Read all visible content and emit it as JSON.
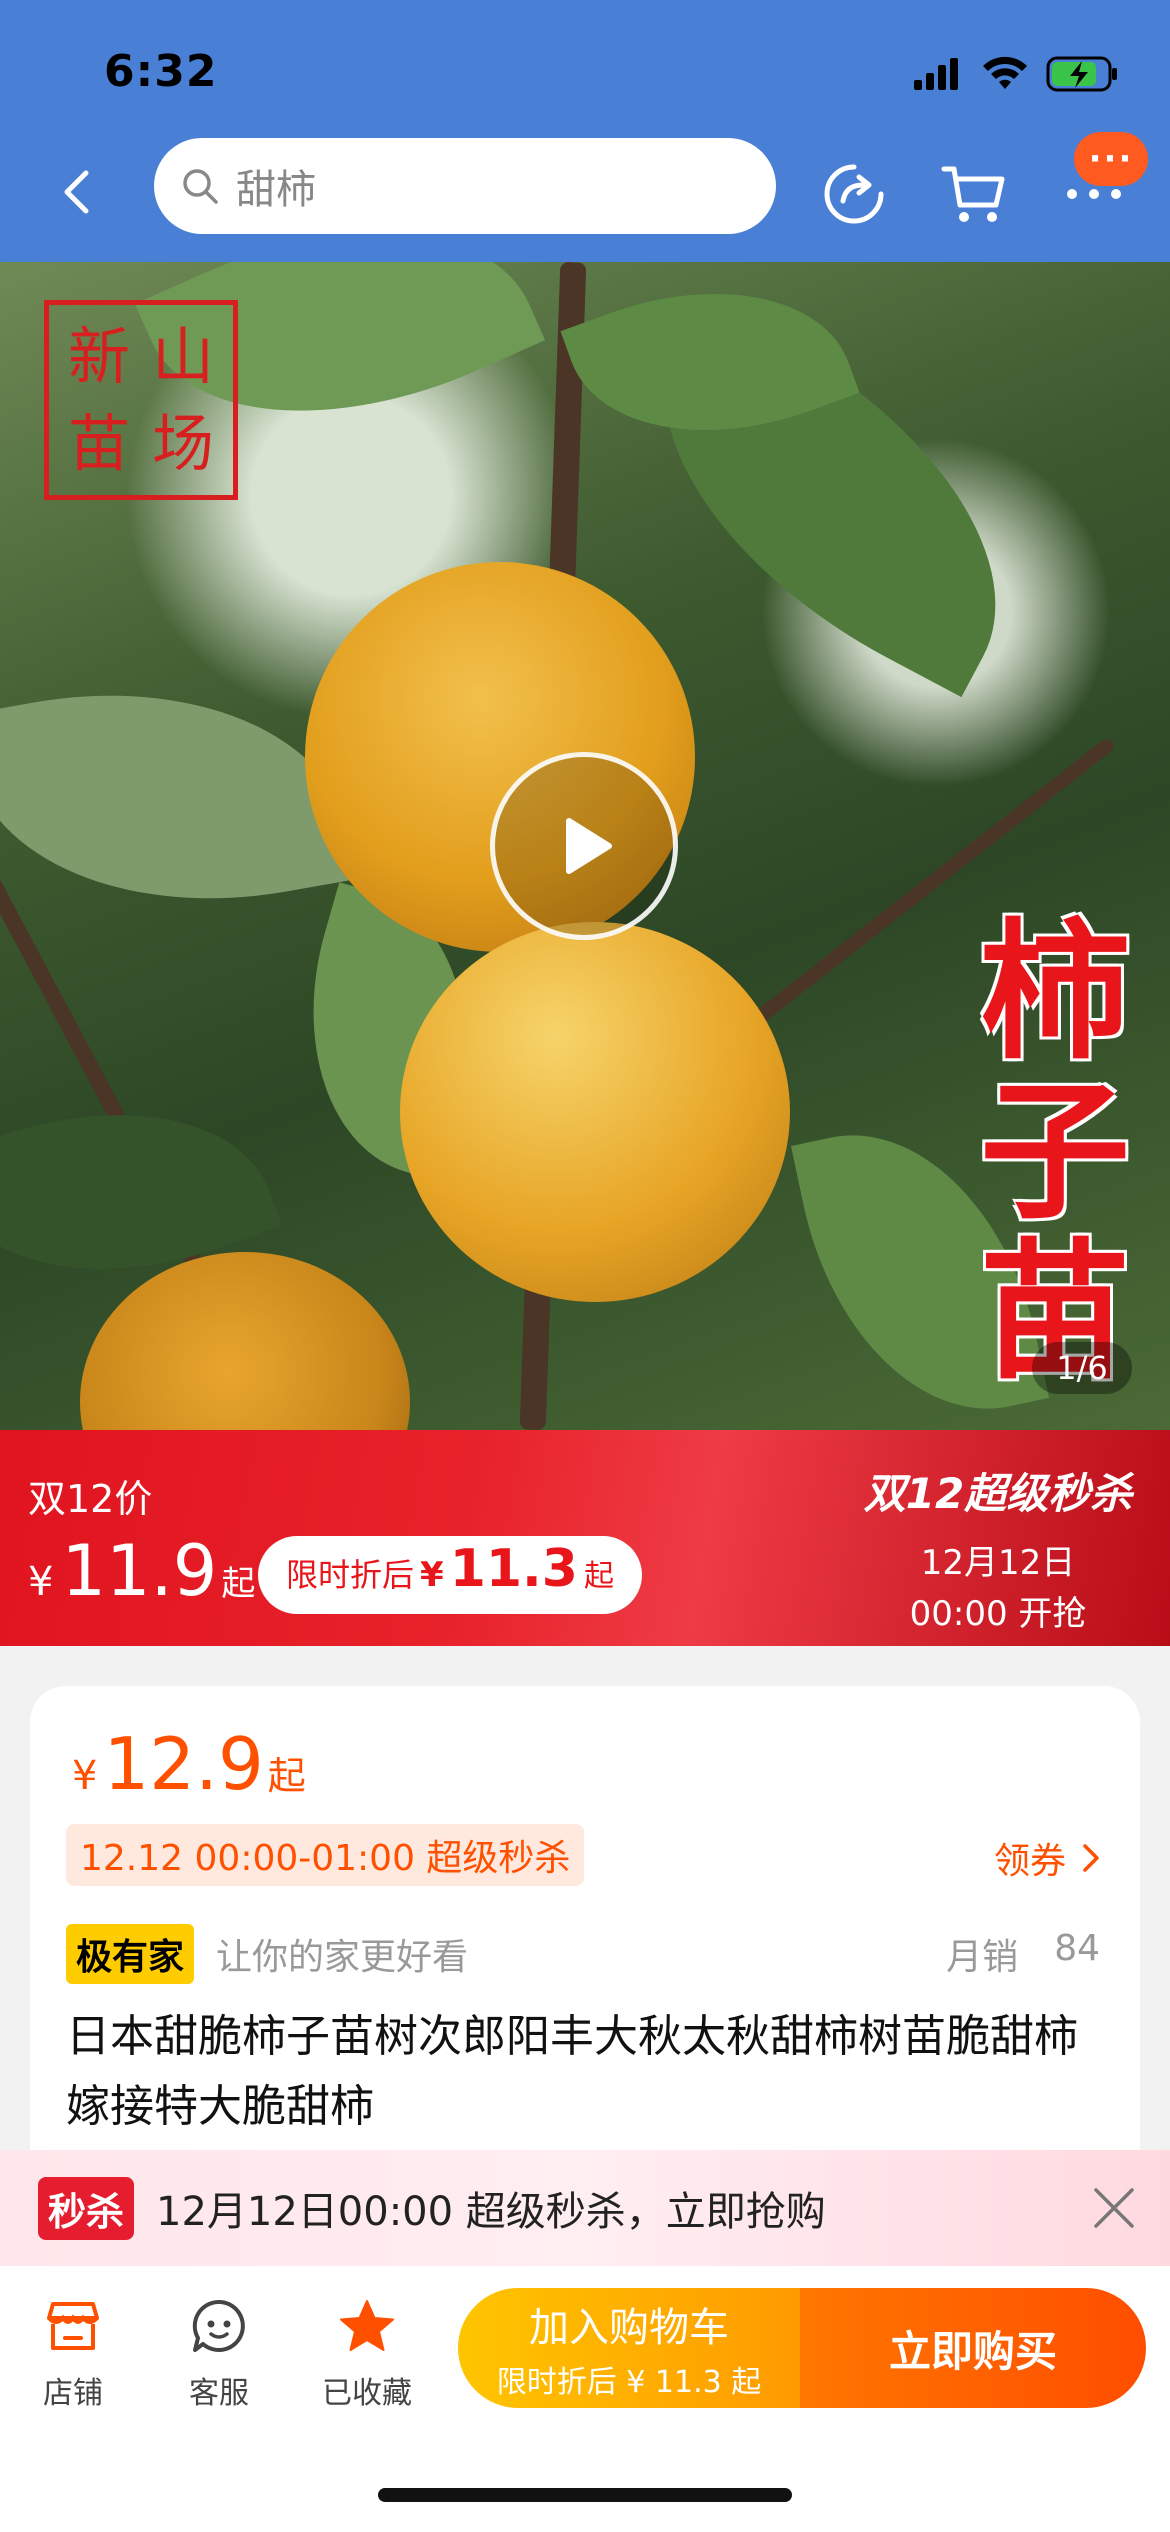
{
  "status": {
    "time": "6:32"
  },
  "search": {
    "query": "甜柿"
  },
  "nav": {
    "more_badge": "···"
  },
  "hero": {
    "seal_chars": [
      "新",
      "山",
      "苗",
      "场"
    ],
    "caption_chars": [
      "柿",
      "子",
      "苗"
    ],
    "pager": "1/6"
  },
  "promo": {
    "label": "双12价",
    "currency": "¥",
    "price": "11.9",
    "price_suffix": "起",
    "pill_text": "限时折后",
    "pill_currency": "¥",
    "pill_price": "11.3",
    "pill_suffix": "起",
    "event_title": "双12超级秒杀",
    "event_date": "12月12日",
    "event_time": "00:00 开抢"
  },
  "product": {
    "currency": "¥",
    "price": "12.9",
    "price_suffix": "起",
    "flash_tag": "12.12 00:00-01:00 超级秒杀",
    "coupon": "领券",
    "brand_badge": "极有家",
    "brand_slogan": "让你的家更好看",
    "sales_label": "月销",
    "sales_count": "84",
    "title": "日本甜脆柿子苗树次郎阳丰大秋太秋甜柿树苗脆甜柿嫁接特大脆甜柿"
  },
  "flashbar": {
    "badge": "秒杀",
    "text": "12月12日00:00 超级秒杀，立即抢购"
  },
  "bottom": {
    "tabs": [
      {
        "label": "店铺",
        "icon": "store-icon"
      },
      {
        "label": "客服",
        "icon": "chat-icon"
      },
      {
        "label": "已收藏",
        "icon": "star-icon"
      }
    ],
    "cart_label": "加入购物车",
    "cart_sub": "限时折后 ¥ 11.3 起",
    "buy_label": "立即购买"
  },
  "colors": {
    "topbar": "#4a7fd6",
    "accent_orange": "#ff5000",
    "promo_red": "#e8161b",
    "favorite_star": "#ff5000"
  }
}
